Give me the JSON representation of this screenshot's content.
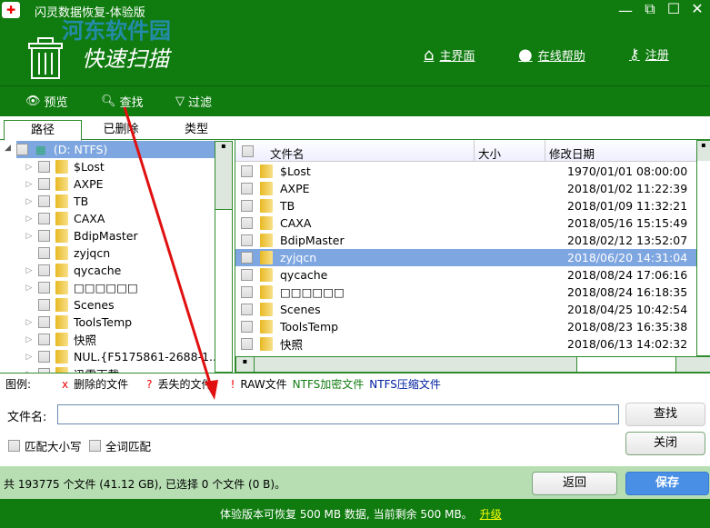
{
  "app": {
    "title": "闪灵数据恢复-体验版",
    "scan_title": "快速扫描",
    "watermark": "河东软件园"
  },
  "header_nav": {
    "home": "主界面",
    "help": "在线帮助",
    "register": "注册"
  },
  "toolbar": {
    "preview": "预览",
    "find": "查找",
    "filter": "过滤"
  },
  "tabs": [
    "路径",
    "已删除",
    "类型"
  ],
  "tree": {
    "root": "(D: NTFS)",
    "items": [
      {
        "label": "$Lost",
        "exp": true
      },
      {
        "label": "AXPE",
        "exp": true
      },
      {
        "label": "TB",
        "exp": true
      },
      {
        "label": "CAXA",
        "exp": true
      },
      {
        "label": "BdipMaster",
        "exp": true
      },
      {
        "label": "zyjqcn",
        "exp": false
      },
      {
        "label": "qycache",
        "exp": true
      },
      {
        "label": "□□□□□□",
        "exp": true
      },
      {
        "label": "Scenes",
        "exp": false
      },
      {
        "label": "ToolsTemp",
        "exp": true
      },
      {
        "label": "快照",
        "exp": true
      },
      {
        "label": "NUL.{F5175861-2688-1...",
        "exp": true
      },
      {
        "label": "迅雷下载",
        "exp": true
      }
    ]
  },
  "list": {
    "columns": [
      "文件名",
      "大小",
      "修改日期"
    ],
    "rows": [
      [
        "$Lost",
        "",
        "1970/01/01 08:00:00"
      ],
      [
        "AXPE",
        "",
        "2018/01/02 11:22:39"
      ],
      [
        "TB",
        "",
        "2018/01/09 11:32:21"
      ],
      [
        "CAXA",
        "",
        "2018/05/16 15:15:49"
      ],
      [
        "BdipMaster",
        "",
        "2018/02/12 13:52:07"
      ],
      [
        "zyjqcn",
        "",
        "2018/06/20 14:31:04"
      ],
      [
        "qycache",
        "",
        "2018/08/24 17:06:16"
      ],
      [
        "□□□□□□",
        "",
        "2018/08/24 16:18:35"
      ],
      [
        "Scenes",
        "",
        "2018/04/25 10:42:54"
      ],
      [
        "ToolsTemp",
        "",
        "2018/08/23 16:35:38"
      ],
      [
        "快照",
        "",
        "2018/06/13 14:02:32"
      ]
    ],
    "selected_index": 5
  },
  "legend": {
    "label": "图例:",
    "deleted": "删除的文件",
    "lost": "丢失的文件",
    "raw": "RAW文件",
    "encrypted": "NTFS加密文件",
    "compressed": "NTFS压缩文件",
    "deleted_mark": "x",
    "lost_mark": "?",
    "raw_mark": "!"
  },
  "search": {
    "label": "文件名:",
    "value": "",
    "find_button": "查找",
    "close_button": "关闭",
    "match_case": "匹配大小写",
    "whole_word": "全词匹配"
  },
  "status": {
    "summary": "共 193775 个文件 (41.12 GB), 已选择 0 个文件 (0 B)。",
    "back_button": "返回",
    "save_button": "保存"
  },
  "footer": {
    "text": "体验版本可恢复 500 MB 数据, 当前剩余 500 MB。",
    "upgrade": "升级"
  },
  "colors": {
    "green": "#107c10",
    "light_green": "#b6deb2",
    "selected": "#7ea6e0",
    "save": "#4a8fe6"
  }
}
